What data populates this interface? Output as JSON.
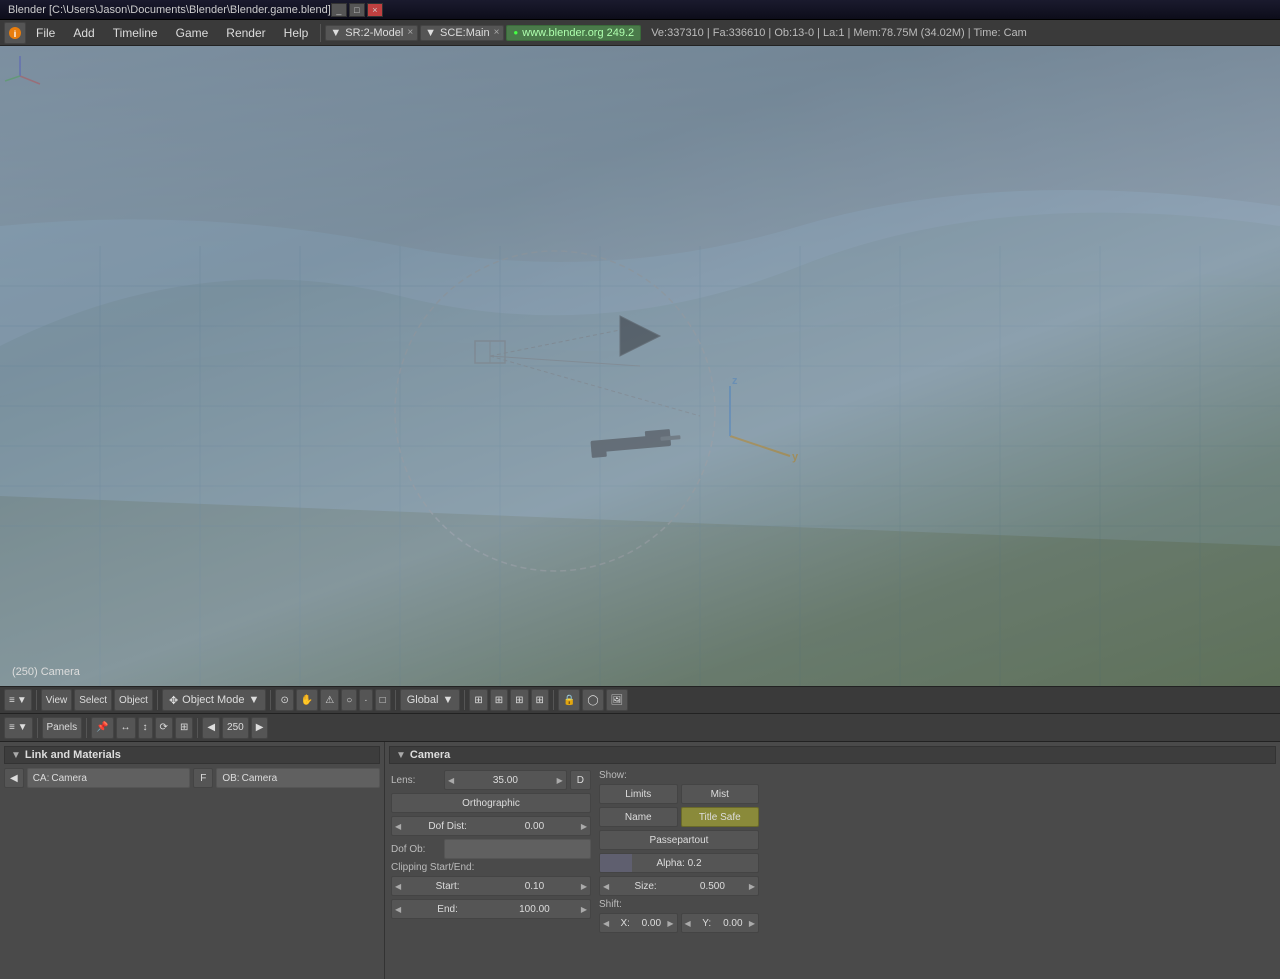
{
  "titlebar": {
    "title": "Blender [C:\\Users\\Jason\\Documents\\Blender\\Blender.game.blend]",
    "controls": [
      "_",
      "□",
      "×"
    ]
  },
  "menubar": {
    "info_icon": "ℹ",
    "items": [
      "File",
      "Add",
      "Timeline",
      "Game",
      "Render",
      "Help"
    ],
    "scene_dropdown": "SR:2-Model",
    "sce_dropdown": "SCE:Main",
    "url": "www.blender.org 249.2",
    "stats": "Ve:337310 | Fa:336610 | Ob:13-0 | La:1 | Mem:78.75M (34.02M) | Time: Cam"
  },
  "viewport": {
    "label": "(250) Camera"
  },
  "toolbar": {
    "view_label": "View",
    "select_label": "Select",
    "object_label": "Object",
    "mode_label": "Object Mode",
    "global_label": "Global",
    "panels_label": "Panels",
    "counter_value": "250"
  },
  "link_materials": {
    "header": "Link and Materials",
    "ca_label": "CA:",
    "ca_value": "Camera",
    "f_label": "F",
    "ob_label": "OB:",
    "ob_value": "Camera"
  },
  "camera": {
    "header": "Camera",
    "lens_label": "Lens:",
    "lens_value": "35.00",
    "d_label": "D",
    "orthographic_label": "Orthographic",
    "show_label": "Show:",
    "limits_label": "Limits",
    "mist_label": "Mist",
    "name_label": "Name",
    "title_safe_label": "Title Safe",
    "dof_dist_label": "Dof Dist:",
    "dof_dist_value": "0.00",
    "passepartout_label": "Passepartout",
    "dof_ob_label": "Dof Ob:",
    "alpha_label": "Alpha: 0.2",
    "size_label": "Size:",
    "size_value": "0.500",
    "clipping_label": "Clipping Start/End:",
    "start_label": "Start:",
    "start_value": "0.10",
    "end_label": "End:",
    "end_value": "100.00",
    "shift_label": "Shift:",
    "shift_x_label": "X:",
    "shift_x_value": "0.00",
    "shift_y_label": "Y:",
    "shift_y_value": "0.00"
  }
}
